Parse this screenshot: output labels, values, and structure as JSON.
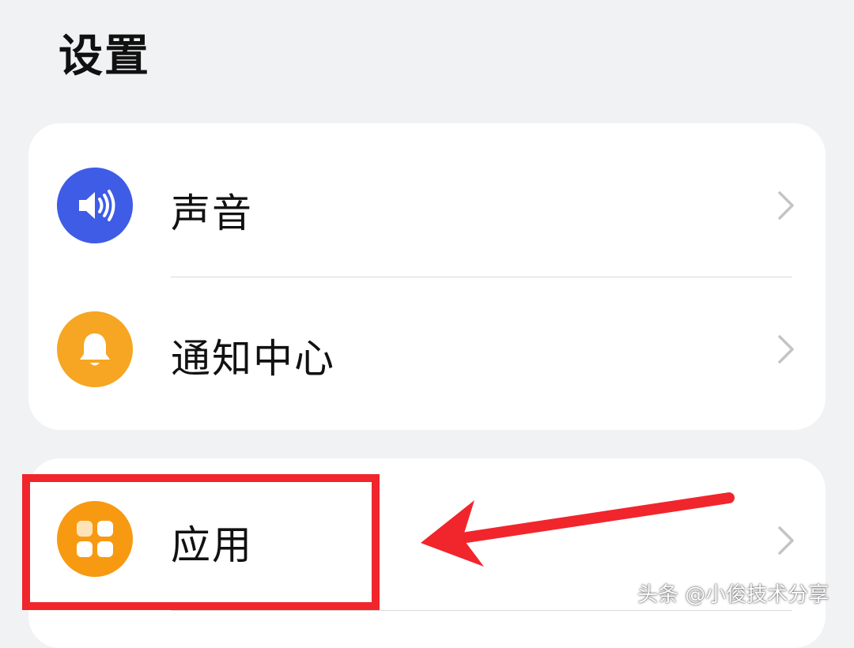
{
  "header": {
    "title": "设置"
  },
  "groups": [
    {
      "items": [
        {
          "label": "声音",
          "icon": "speaker-icon",
          "color": "#3e5ce6"
        },
        {
          "label": "通知中心",
          "icon": "bell-icon",
          "color": "#f6a623"
        }
      ]
    },
    {
      "items": [
        {
          "label": "应用",
          "icon": "apps-icon",
          "color": "#f79a12"
        }
      ]
    }
  ],
  "annotation": {
    "color": "#f0262c",
    "target": "应用"
  },
  "watermark": {
    "text": "头条 @小俊技术分享"
  }
}
